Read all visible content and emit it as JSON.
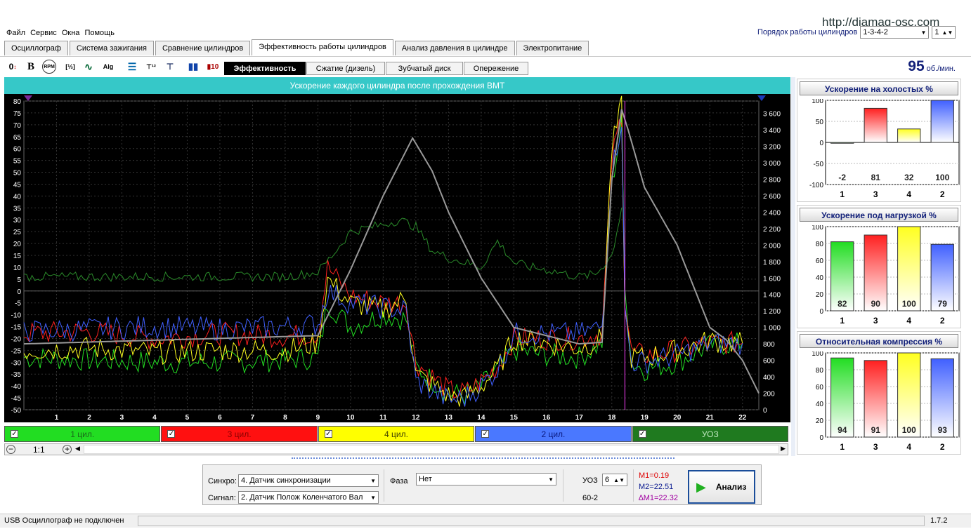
{
  "url": "http://diamag-osc.com",
  "menu": [
    "Файл",
    "Сервис",
    "Окна",
    "Помощь"
  ],
  "firing_order": {
    "label": "Порядок работы цилиндров",
    "value": "1-3-4-2",
    "num": "1"
  },
  "tabs": [
    "Осциллограф",
    "Система зажигания",
    "Сравнение цилиндров",
    "Эффективность работы цилиндров",
    "Анализ давления в цилиндре",
    "Электропитание"
  ],
  "active_tab": "Эффективность работы цилиндров",
  "toolbar_icons": [
    "zero-shift-icon",
    "bold-b-icon",
    "rpm-icon",
    "cursor-scale-icon",
    "sine-wave-icon",
    "alg-icon",
    "bug-icon",
    "numeric-scale-icon",
    "filter-icon",
    "bars-icon",
    "counter-icon"
  ],
  "subtabs": [
    "Эффективность",
    "Сжатие (дизель)",
    "Зубчатый диск",
    "Опережение"
  ],
  "active_subtab": "Эффективность",
  "rpm": {
    "value": "95",
    "unit": "об./мин."
  },
  "chart": {
    "title": "Ускорение каждого цилиндра после прохождения ВМТ",
    "y_left_ticks": [
      "80",
      "75",
      "70",
      "65",
      "60",
      "55",
      "50",
      "45",
      "40",
      "35",
      "30",
      "25",
      "20",
      "15",
      "10",
      "5",
      "0",
      "-5",
      "-10",
      "-15",
      "-20",
      "-25",
      "-30",
      "-35",
      "-40",
      "-45",
      "-50"
    ],
    "y_right_ticks": [
      "3 600",
      "3 400",
      "3 200",
      "3 000",
      "2 800",
      "2 600",
      "2 400",
      "2 200",
      "2 000",
      "1 800",
      "1 600",
      "1 400",
      "1 200",
      "1 000",
      "800",
      "600",
      "400",
      "200",
      "0"
    ],
    "x_ticks": [
      "1",
      "2",
      "3",
      "4",
      "5",
      "6",
      "7",
      "8",
      "9",
      "10",
      "11",
      "12",
      "13",
      "14",
      "15",
      "16",
      "17",
      "18",
      "19",
      "20",
      "21",
      "22"
    ]
  },
  "chart_data": [
    {
      "type": "line",
      "title": "Ускорение каждого цилиндра после прохождения ВМТ",
      "x_range": [
        0,
        22.5
      ],
      "ylim": [
        -50,
        80
      ],
      "y2lim": [
        0,
        3750
      ],
      "grid": true,
      "series": [
        {
          "name": "1 цил.",
          "color": "#22dd22",
          "x": [
            0,
            2,
            4,
            6,
            8,
            9,
            9.3,
            10,
            11,
            11.7,
            12,
            13,
            13.5,
            14,
            14.5,
            15,
            16,
            17,
            17.7,
            18,
            18.3,
            18.4,
            18.6,
            19,
            20,
            21,
            22
          ],
          "y": [
            -28,
            -29,
            -30,
            -30,
            -29,
            -28,
            -5,
            -15,
            -10,
            -12,
            -32,
            -43,
            -44,
            -40,
            -33,
            -25,
            -27,
            -28,
            -22,
            45,
            70,
            5,
            -30,
            -33,
            -30,
            -23,
            -22
          ]
        },
        {
          "name": "3 цил.",
          "color": "#ff2020",
          "x": [
            0,
            2,
            4,
            6,
            8,
            9,
            9.3,
            10,
            11,
            11.7,
            12,
            13,
            13.5,
            14,
            14.5,
            15,
            16,
            17,
            17.7,
            18,
            18.3,
            18.4,
            18.6,
            19,
            20,
            21,
            22
          ],
          "y": [
            -18,
            -17,
            -20,
            -18,
            -19,
            -18,
            10,
            -2,
            -5,
            -5,
            -30,
            -42,
            -43,
            -38,
            -32,
            -20,
            -20,
            -20,
            -18,
            55,
            75,
            -5,
            -26,
            -27,
            -25,
            -22,
            -22
          ]
        },
        {
          "name": "4 цил.",
          "color": "#ffff20",
          "x": [
            0,
            2,
            4,
            6,
            8,
            9,
            9.3,
            10,
            11,
            11.7,
            12,
            13,
            13.5,
            14,
            14.5,
            15,
            16,
            17,
            17.7,
            18,
            18.3,
            18.4,
            18.6,
            19,
            20,
            21,
            22
          ],
          "y": [
            -25,
            -24,
            -26,
            -25,
            -25,
            -22,
            5,
            -5,
            -8,
            -3,
            -35,
            -44,
            -45,
            -40,
            -33,
            -20,
            -22,
            -24,
            -20,
            60,
            78,
            -10,
            -28,
            -28,
            -25,
            -21,
            -22
          ]
        },
        {
          "name": "2 цил.",
          "color": "#4060ff",
          "x": [
            0,
            2,
            4,
            6,
            8,
            9,
            9.3,
            10,
            11,
            11.7,
            12,
            13,
            13.5,
            14,
            14.5,
            15,
            16,
            17,
            17.7,
            18,
            18.3,
            18.4,
            18.6,
            19,
            20,
            21,
            22
          ],
          "y": [
            -17,
            -16,
            -15,
            -16,
            -15,
            -14,
            0,
            -5,
            -7,
            -8,
            -38,
            -46,
            -45,
            -40,
            -33,
            -18,
            -18,
            -18,
            -15,
            50,
            72,
            -8,
            -30,
            -30,
            -27,
            -22,
            -22
          ]
        },
        {
          "name": "УОЗ",
          "color": "#2a8a2a",
          "x": [
            0,
            1,
            2,
            3,
            4,
            5,
            6,
            7,
            8,
            9,
            9.5,
            10,
            11,
            11.5,
            12,
            12.5,
            13,
            14,
            14.5,
            15,
            15.5,
            16,
            17,
            17.5,
            18,
            18.3
          ],
          "y": [
            6,
            6,
            6,
            6,
            6,
            6,
            6,
            6,
            6,
            8,
            16,
            25,
            28,
            30,
            27,
            17,
            14,
            10,
            21,
            12,
            10,
            9,
            6,
            7,
            15,
            35
          ]
        },
        {
          "name": "",
          "axis": "right",
          "color": "#999999",
          "x": [
            0,
            9,
            10,
            11,
            11.9,
            12.5,
            13,
            14,
            15,
            16,
            17,
            17.7,
            18,
            18.3,
            18.5,
            19,
            20,
            21,
            21.5,
            22,
            22.5
          ],
          "y": [
            800,
            900,
            1700,
            2600,
            3300,
            2900,
            2400,
            1600,
            1000,
            900,
            800,
            820,
            2800,
            3650,
            3400,
            2700,
            2000,
            1000,
            850,
            600,
            200
          ]
        }
      ]
    },
    {
      "type": "bar",
      "title": "Ускорение на холостых %",
      "categories": [
        "1",
        "3",
        "4",
        "2"
      ],
      "values": [
        -2,
        81,
        32,
        100
      ],
      "ylim": [
        -100,
        100
      ],
      "yticks": [
        "100",
        "50",
        "0",
        "-50",
        "-100"
      ],
      "colors": [
        "#22dd22",
        "#ff2020",
        "#ffff20",
        "#4060ff"
      ]
    },
    {
      "type": "bar",
      "title": "Ускорение под нагрузкой %",
      "categories": [
        "1",
        "3",
        "4",
        "2"
      ],
      "values": [
        82,
        90,
        100,
        79
      ],
      "ylim": [
        0,
        100
      ],
      "yticks": [
        "100",
        "80",
        "60",
        "40",
        "20",
        "0"
      ],
      "colors": [
        "#22dd22",
        "#ff2020",
        "#ffff20",
        "#4060ff"
      ]
    },
    {
      "type": "bar",
      "title": "Относительная компрессия %",
      "categories": [
        "1",
        "3",
        "4",
        "2"
      ],
      "values": [
        94,
        91,
        100,
        93
      ],
      "ylim": [
        0,
        100
      ],
      "yticks": [
        "100",
        "80",
        "60",
        "40",
        "20",
        "0"
      ],
      "colors": [
        "#22dd22",
        "#ff2020",
        "#ffff20",
        "#4060ff"
      ]
    }
  ],
  "legend": [
    {
      "label": "1 цил.",
      "bg": "#22dd22",
      "fg": "#1a6a1a"
    },
    {
      "label": "3 цил.",
      "bg": "#ff1010",
      "fg": "#8a0000"
    },
    {
      "label": "4 цил.",
      "bg": "#ffff00",
      "fg": "#444400"
    },
    {
      "label": "2 цил.",
      "bg": "#4a78ff",
      "fg": "#0a1a80"
    },
    {
      "label": "УОЗ",
      "bg": "#1f7a1f",
      "fg": "#bfe8bf"
    }
  ],
  "scroll": {
    "ratio": "1:1"
  },
  "bottom": {
    "sync_label": "Синхро:",
    "sync_value": "4.  Датчик синхронизации",
    "signal_label": "Сигнал:",
    "signal_value": "2.  Датчик Полож Коленчатого Вал",
    "phase_label": "Фаза",
    "phase_value": "Нет",
    "uoz_label": "УОЗ",
    "uoz_value": "6",
    "teeth": "60-2",
    "m1": "M1=0.19",
    "m2": "M2=22.51",
    "dm": "∆M1=22.32",
    "analyze": "Анализ"
  },
  "status": {
    "left": "USB Осциллограф не подключен",
    "version": "1.7.2"
  }
}
